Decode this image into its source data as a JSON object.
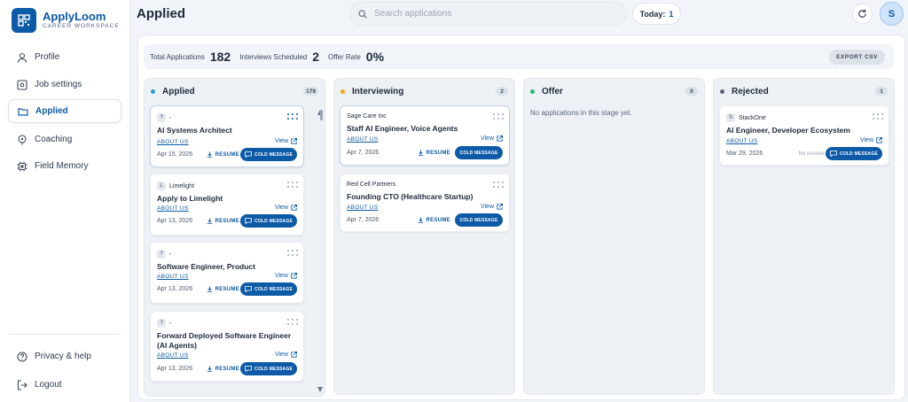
{
  "app": {
    "name": "ApplyLoom",
    "subtitle": "CAREER WORKSPACE"
  },
  "sidebar": {
    "items": [
      {
        "label": "Profile",
        "icon": "user-icon"
      },
      {
        "label": "Job settings",
        "icon": "settings-box-icon"
      },
      {
        "label": "Applied",
        "icon": "folder-icon",
        "active": true
      },
      {
        "label": "Coaching",
        "icon": "coaching-icon"
      },
      {
        "label": "Field Memory",
        "icon": "chip-icon"
      }
    ],
    "bottom": [
      {
        "label": "Privacy & help",
        "icon": "help-icon"
      },
      {
        "label": "Logout",
        "icon": "logout-icon"
      }
    ]
  },
  "header": {
    "title": "Applied",
    "search_placeholder": "Search applications",
    "today_label": "Today:",
    "today_count": "1",
    "avatar_initial": "S"
  },
  "stats": {
    "total_label": "Total Applications",
    "total_value": "182",
    "interviews_label": "Interviews Scheduled",
    "interviews_value": "2",
    "offer_label": "Offer Rate",
    "offer_value": "0%",
    "export_label": "EXPORT CSV"
  },
  "labels": {
    "about": "ABOUT US",
    "view": "View",
    "resume": "RESUME",
    "cold": "COLD MESSAGE",
    "no_resume": "No resume"
  },
  "colors": {
    "accent": "#0d5aa7",
    "applied": "#2b9bd8",
    "interviewing": "#f2a516",
    "offer": "#22b573",
    "rejected": "#5a6675"
  },
  "columns": [
    {
      "title": "Applied",
      "count": "179",
      "cards": [
        {
          "badge": "?",
          "company": "-",
          "role": "AI Systems Architect",
          "date": "Apr 15, 2026"
        },
        {
          "badge": "L",
          "company": "Limelight",
          "role": "Apply to Limelight",
          "date": "Apr 13, 2026"
        },
        {
          "badge": "?",
          "company": "-",
          "role": "Software Engineer, Product",
          "date": "Apr 13, 2026"
        },
        {
          "badge": "?",
          "company": "-",
          "role": "Forward Deployed Software Engineer (AI Agents)",
          "date": "Apr 13, 2026"
        }
      ]
    },
    {
      "title": "Interviewing",
      "count": "2",
      "cards": [
        {
          "company": "Sage Care Inc",
          "role": "Staff AI Engineer, Voice Agents",
          "date": "Apr 7, 2026"
        },
        {
          "company": "Red Cell Partners",
          "role": "Founding CTO (Healthcare Startup)",
          "date": "Apr 7, 2026"
        }
      ]
    },
    {
      "title": "Offer",
      "count": "0",
      "empty": "No applications in this stage yet."
    },
    {
      "title": "Rejected",
      "count": "1",
      "cards": [
        {
          "badge": "S",
          "company": "StackOne",
          "role": "AI Engineer, Developer Ecosystem",
          "date": "Mar 29, 2026"
        }
      ]
    }
  ]
}
